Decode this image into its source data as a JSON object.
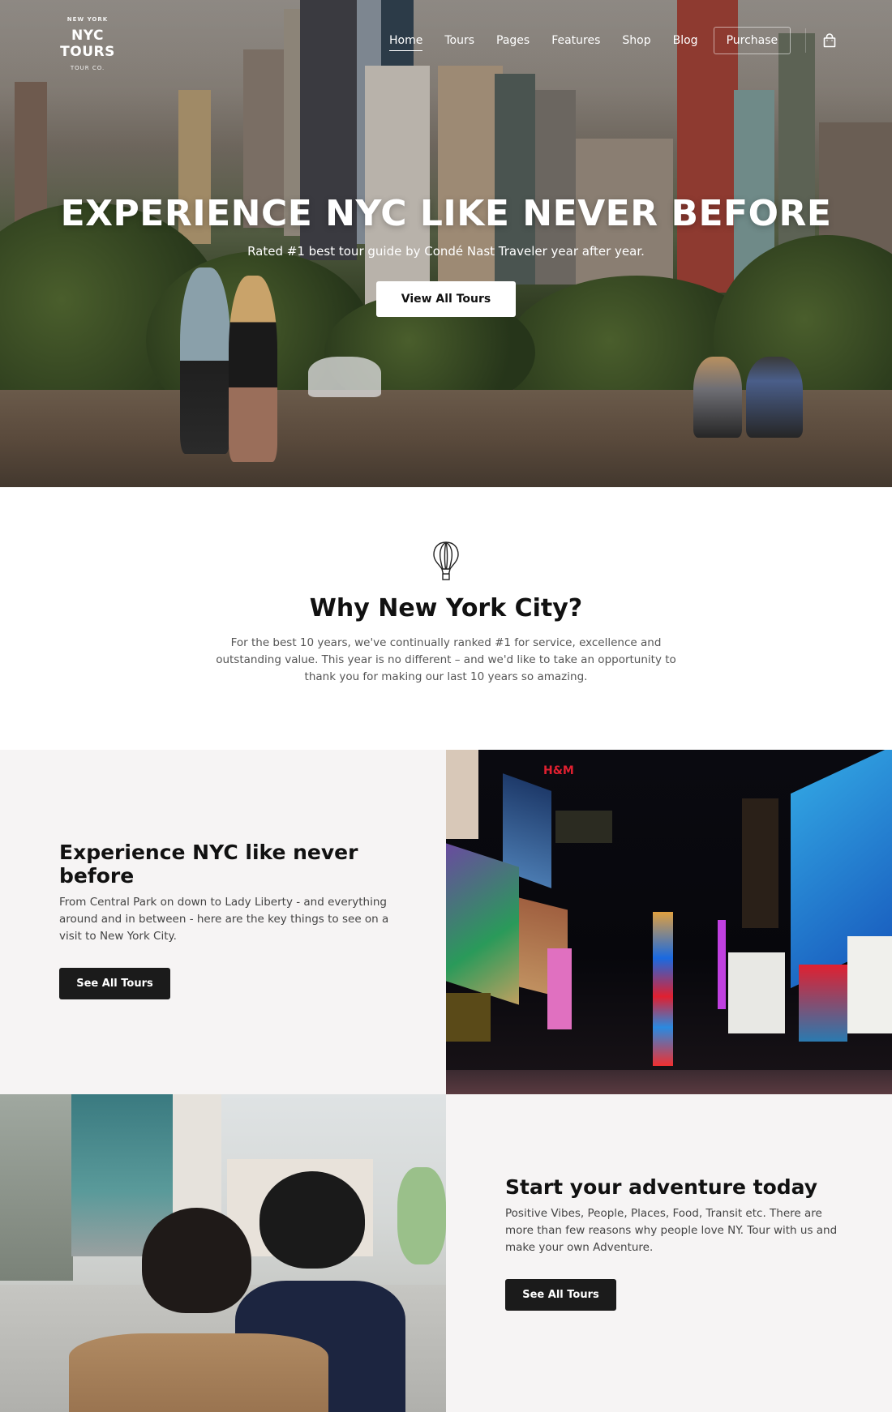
{
  "nav": {
    "logo": {
      "top": "NEW YORK",
      "main": "NYC TOURS",
      "bottom": "TOUR CO."
    },
    "items": [
      {
        "label": "Home",
        "active": true
      },
      {
        "label": "Tours",
        "active": false
      },
      {
        "label": "Pages",
        "active": false
      },
      {
        "label": "Features",
        "active": false
      },
      {
        "label": "Shop",
        "active": false
      },
      {
        "label": "Blog",
        "active": false
      }
    ],
    "purchase_label": "Purchase",
    "cart_icon": "shopping-bag-icon"
  },
  "hero": {
    "title": "EXPERIENCE NYC LIKE NEVER BEFORE",
    "subtitle": "Rated #1 best tour guide by Condé Nast Traveler year after year.",
    "button_label": "View All Tours"
  },
  "why": {
    "icon": "hot-air-balloon-icon",
    "title": "Why New York City?",
    "text": "For the best 10 years, we've continually ranked #1 for service, excellence and outstanding value. This year is no different – and we'd like to take an opportunity to thank you for making our last 10 years so amazing."
  },
  "features": [
    {
      "title": "Experience NYC like never before",
      "text": "From Central Park on down to Lady Liberty - and everything around and in between - here are the key things to see on a visit to New York City.",
      "button_label": "See All Tours",
      "image": "times-square-night-photo"
    },
    {
      "title": "Start your adventure today",
      "text": "Positive Vibes, People, Places, Food, Transit etc. There are more than few reasons why people love NY. Tour with us and make your own Adventure.",
      "button_label": "See All Tours",
      "image": "two-men-walking-street-photo"
    }
  ],
  "colors": {
    "panel_bg": "#f6f4f4",
    "button_dark": "#1b1b1b",
    "text_dark": "#111111",
    "text_muted": "#555555"
  }
}
